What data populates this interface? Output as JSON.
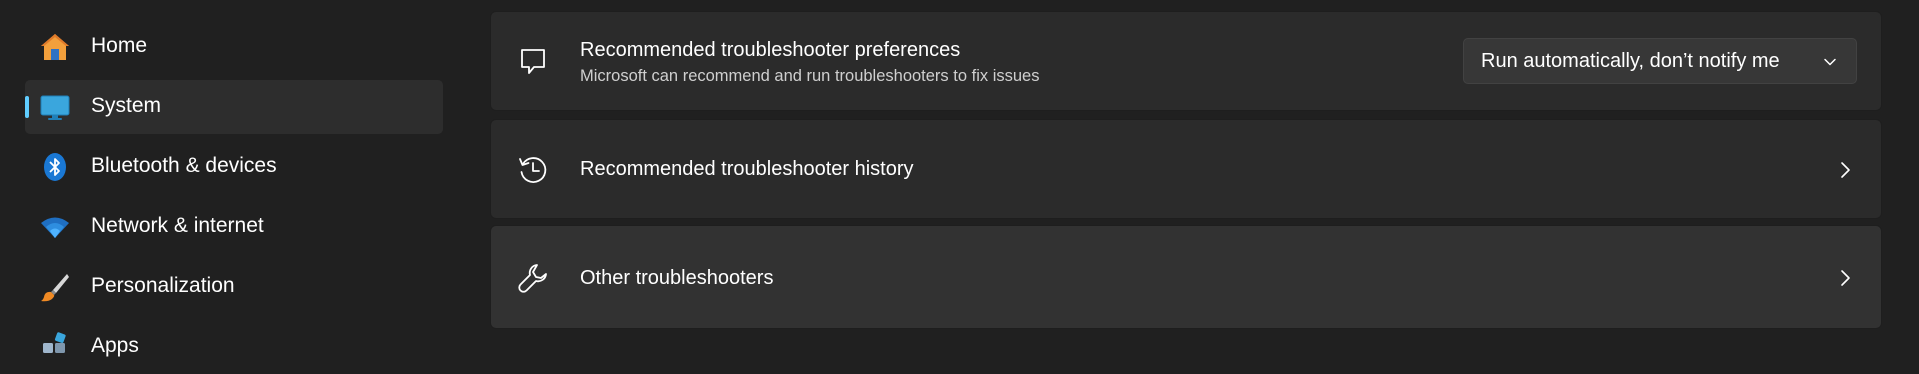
{
  "sidebar": {
    "items": [
      {
        "label": "Home",
        "icon": "home-icon"
      },
      {
        "label": "System",
        "icon": "monitor-icon",
        "selected": true
      },
      {
        "label": "Bluetooth & devices",
        "icon": "bluetooth-icon"
      },
      {
        "label": "Network & internet",
        "icon": "wifi-icon"
      },
      {
        "label": "Personalization",
        "icon": "brush-icon"
      },
      {
        "label": "Apps",
        "icon": "apps-icon"
      }
    ]
  },
  "main": {
    "preferences": {
      "title": "Recommended troubleshooter preferences",
      "subtitle": "Microsoft can recommend and run troubleshooters to fix issues",
      "icon": "chat-bubble-icon",
      "dropdown_value": "Run automatically, don’t notify me"
    },
    "history": {
      "title": "Recommended troubleshooter history",
      "icon": "history-icon"
    },
    "other": {
      "title": "Other troubleshooters",
      "icon": "wrench-icon"
    }
  },
  "colors": {
    "background": "#202020",
    "card": "#2b2b2b",
    "accent": "#60cdff"
  }
}
